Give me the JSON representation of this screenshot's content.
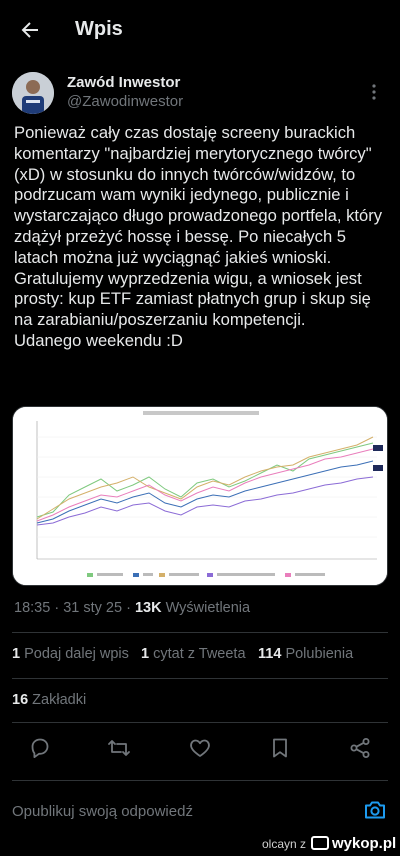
{
  "header": {
    "title": "Wpis"
  },
  "author": {
    "name": "Zawód Inwestor",
    "handle": "@Zawodinwestor"
  },
  "tweet": {
    "text": "Ponieważ cały czas dostaję screeny burackich komentarzy \"najbardziej merytorycznego twórcy\" (xD) w stosunku do innych twórców/widzów, to podrzucam wam wyniki jedynego, publicznie i wystarczająco długo prowadzonego portfela, który zdążył przeżyć hossę i bessę. Po niecałych 5 latach można już wyciągnąć jakieś wnioski.\nGratulujemy wyprzedzenia wigu, a wniosek jest prosty: kup ETF zamiast płatnych grup i skup się na zarabianiu/poszerzaniu kompetencji.\nUdanego weekendu :D"
  },
  "meta": {
    "time": "18:35",
    "sep1": "·",
    "date": "31 sty 25",
    "sep2": "·",
    "views_count": "13K",
    "views_label": "Wyświetlenia"
  },
  "stats": {
    "reposts_count": "1",
    "reposts_label": "Podaj dalej wpis",
    "quotes_count": "1",
    "quotes_label": "cytat z Tweeta",
    "likes_count": "114",
    "likes_label": "Polubienia",
    "bookmarks_count": "16",
    "bookmarks_label": "Zakładki"
  },
  "reply": {
    "placeholder": "Opublikuj swoją odpowiedź"
  },
  "footer": {
    "user": "olcayn",
    "separator": "z",
    "site": "wykop.pl"
  },
  "icons": {
    "back": "arrow-left-icon",
    "more": "more-vertical-icon",
    "reply": "comment-icon",
    "repost": "repost-icon",
    "like": "heart-icon",
    "bookmark": "bookmark-icon",
    "share": "share-icon",
    "camera": "camera-icon"
  },
  "colors": {
    "background": "#000000",
    "text": "#e7e9ea",
    "muted": "#71767b",
    "accent": "#1d9bf0",
    "divider": "#2f3336"
  }
}
